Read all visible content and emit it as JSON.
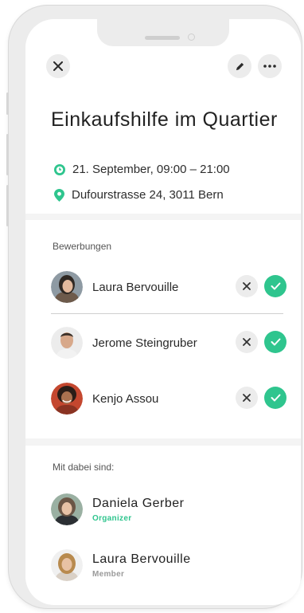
{
  "header": {
    "close_icon": "close-icon",
    "edit_icon": "pencil-icon",
    "more_icon": "more-icon"
  },
  "event": {
    "title": "Einkaufshilfe im Quartier",
    "datetime": "21. September, 09:00 – 21:00",
    "location": "Dufourstrasse 24, 3011 Bern"
  },
  "applications": {
    "label": "Bewerbungen",
    "items": [
      {
        "name": "Laura Bervouille"
      },
      {
        "name": "Jerome Steingruber"
      },
      {
        "name": "Kenjo Assou"
      }
    ]
  },
  "team": {
    "label": "Mit dabei sind:",
    "members": [
      {
        "name": "Daniela Gerber",
        "role": "Organizer"
      },
      {
        "name": "Laura Bervouille",
        "role": "Member"
      }
    ]
  },
  "colors": {
    "accent": "#2fc58e",
    "organizer_role": "#2fc58e",
    "member_role": "#9a9a9a"
  }
}
